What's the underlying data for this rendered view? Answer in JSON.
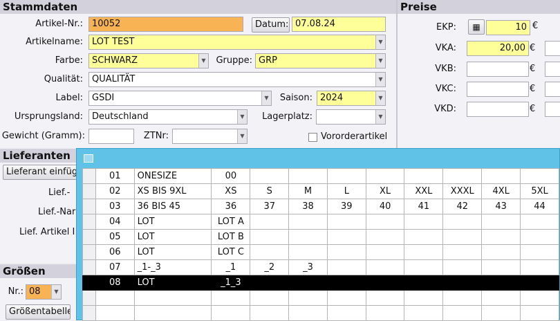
{
  "stammdaten": {
    "title": "Stammdaten",
    "artikel_nr_label": "Artikel-Nr.:",
    "artikel_nr": "10052",
    "datum_button": "Datum:",
    "datum": "07.08.24",
    "artikelname_label": "Artikelname:",
    "artikelname": "LOT TEST",
    "farbe_label": "Farbe:",
    "farbe": "SCHWARZ",
    "gruppe_label": "Gruppe:",
    "gruppe": "GRP",
    "qualitaet_label": "Qualität:",
    "qualitaet": "QUALITÄT",
    "label_label": "Label:",
    "label": "GSDI",
    "saison_label": "Saison:",
    "saison": "2024",
    "ursprungsland_label": "Ursprungsland:",
    "ursprungsland": "Deutschland",
    "lagerplatz_label": "Lagerplatz:",
    "lagerplatz": "",
    "gewicht_label": "Gewicht (Gramm):",
    "gewicht": "",
    "ztnr_label": "ZTNr:",
    "ztnr": "",
    "vororder_label": "Vororderartikel"
  },
  "preise": {
    "title": "Preise",
    "currency": "€",
    "ekp_label": "EKP:",
    "ekp": "10",
    "vka_label": "VKA:",
    "vka": "20,00",
    "vkb_label": "VKB:",
    "vkb": "",
    "vkc_label": "VKC:",
    "vkc": "",
    "vkd_label": "VKD:",
    "vkd": ""
  },
  "lieferanten": {
    "title": "Lieferanten",
    "add_button": "Lieferant einfüg",
    "lief_label": "Lief.-",
    "lief_name_label": "Lief.-Nar",
    "lief_artikel_label": "Lief. Artikel I"
  },
  "groessen": {
    "title": "Größen Bestä",
    "nr_label": "Nr.:",
    "nr": "08",
    "table_button": "Größentabelle"
  },
  "grid": {
    "rows": [
      {
        "nr": "01",
        "name": "ONESIZE",
        "sizes": [
          "00",
          "",
          "",
          "",
          "",
          "",
          "",
          "",
          ""
        ],
        "selected": false
      },
      {
        "nr": "02",
        "name": "XS BIS 9XL",
        "sizes": [
          "XS",
          "S",
          "M",
          "L",
          "XL",
          "XXL",
          "XXXL",
          "4XL",
          "5XL"
        ],
        "selected": false
      },
      {
        "nr": "03",
        "name": "36 BIS 45",
        "sizes": [
          "36",
          "37",
          "38",
          "39",
          "40",
          "41",
          "42",
          "43",
          "44"
        ],
        "selected": false
      },
      {
        "nr": "04",
        "name": "LOT",
        "sizes": [
          "LOT A",
          "",
          "",
          "",
          "",
          "",
          "",
          "",
          ""
        ],
        "selected": false
      },
      {
        "nr": "05",
        "name": "LOT",
        "sizes": [
          "LOT B",
          "",
          "",
          "",
          "",
          "",
          "",
          "",
          ""
        ],
        "selected": false
      },
      {
        "nr": "06",
        "name": "LOT",
        "sizes": [
          "LOT C",
          "",
          "",
          "",
          "",
          "",
          "",
          "",
          ""
        ],
        "selected": false
      },
      {
        "nr": "07",
        "name": "_1-_3",
        "sizes": [
          "_1",
          "_2",
          "_3",
          "",
          "",
          "",
          "",
          "",
          ""
        ],
        "selected": false
      },
      {
        "nr": "08",
        "name": "LOT",
        "sizes": [
          "_1_3",
          "",
          "",
          "",
          "",
          "",
          "",
          "",
          ""
        ],
        "selected": true
      },
      {
        "nr": "",
        "name": "",
        "sizes": [
          "",
          "",
          "",
          "",
          "",
          "",
          "",
          "",
          ""
        ],
        "selected": false
      },
      {
        "nr": "",
        "name": "",
        "sizes": [
          "",
          "",
          "",
          "",
          "",
          "",
          "",
          "",
          ""
        ],
        "selected": false
      }
    ]
  }
}
